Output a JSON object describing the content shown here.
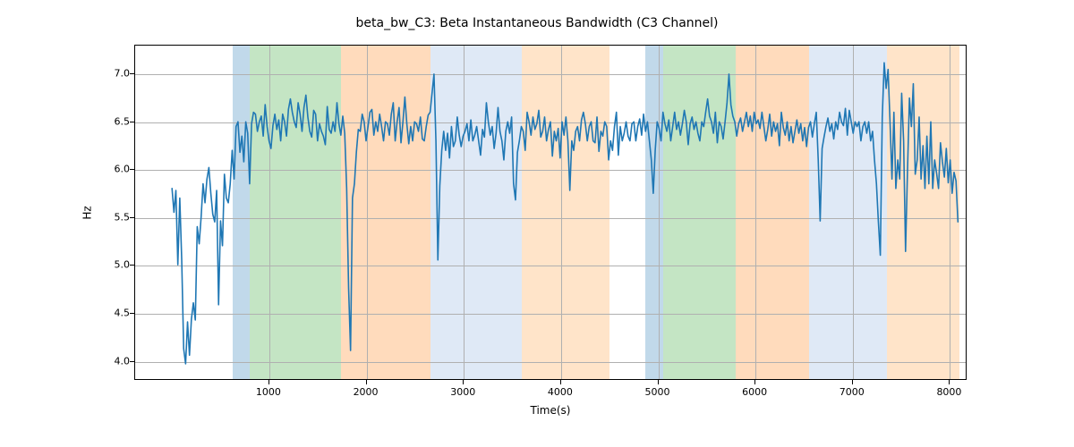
{
  "chart_data": {
    "type": "line",
    "title": "beta_bw_C3: Beta Instantaneous Bandwidth (C3 Channel)",
    "xlabel": "Time(s)",
    "ylabel": "Hz",
    "xlim": [
      -380,
      8180
    ],
    "ylim": [
      3.8,
      7.3
    ],
    "xticks": [
      1000,
      2000,
      3000,
      4000,
      5000,
      6000,
      7000,
      8000
    ],
    "yticks": [
      4.0,
      4.5,
      5.0,
      5.5,
      6.0,
      6.5,
      7.0
    ],
    "bands": [
      {
        "x0": 620,
        "x1": 800,
        "class": "blue"
      },
      {
        "x0": 800,
        "x1": 1740,
        "class": "green"
      },
      {
        "x0": 1740,
        "x1": 2660,
        "class": "orange"
      },
      {
        "x0": 2660,
        "x1": 3600,
        "class": "pale"
      },
      {
        "x0": 3600,
        "x1": 4500,
        "class": "peach"
      },
      {
        "x0": 4870,
        "x1": 5050,
        "class": "blue"
      },
      {
        "x0": 5050,
        "x1": 5800,
        "class": "green"
      },
      {
        "x0": 5800,
        "x1": 6550,
        "class": "orange"
      },
      {
        "x0": 6550,
        "x1": 7350,
        "class": "pale"
      },
      {
        "x0": 7350,
        "x1": 8100,
        "class": "peach"
      }
    ],
    "series": [
      {
        "name": "beta_bw_C3",
        "color": "#1f77b4",
        "x": [
          0,
          20,
          40,
          60,
          80,
          100,
          120,
          140,
          160,
          180,
          200,
          220,
          240,
          260,
          280,
          300,
          320,
          340,
          360,
          380,
          400,
          420,
          440,
          460,
          480,
          500,
          520,
          540,
          560,
          580,
          600,
          620,
          640,
          660,
          680,
          700,
          720,
          740,
          760,
          780,
          800,
          820,
          840,
          860,
          880,
          900,
          920,
          940,
          960,
          980,
          1000,
          1020,
          1040,
          1060,
          1080,
          1100,
          1120,
          1140,
          1160,
          1180,
          1200,
          1220,
          1240,
          1260,
          1280,
          1300,
          1320,
          1340,
          1360,
          1380,
          1400,
          1420,
          1440,
          1460,
          1480,
          1500,
          1520,
          1540,
          1560,
          1580,
          1600,
          1620,
          1640,
          1660,
          1680,
          1700,
          1720,
          1740,
          1760,
          1780,
          1800,
          1820,
          1840,
          1860,
          1880,
          1900,
          1920,
          1940,
          1960,
          1980,
          2000,
          2020,
          2040,
          2060,
          2080,
          2100,
          2120,
          2140,
          2160,
          2180,
          2200,
          2220,
          2240,
          2260,
          2280,
          2300,
          2320,
          2340,
          2360,
          2380,
          2400,
          2420,
          2440,
          2460,
          2480,
          2500,
          2520,
          2540,
          2560,
          2580,
          2600,
          2620,
          2640,
          2660,
          2680,
          2700,
          2720,
          2740,
          2760,
          2780,
          2800,
          2820,
          2840,
          2860,
          2880,
          2900,
          2920,
          2940,
          2960,
          2980,
          3000,
          3020,
          3040,
          3060,
          3080,
          3100,
          3120,
          3140,
          3160,
          3180,
          3200,
          3220,
          3240,
          3260,
          3280,
          3300,
          3320,
          3340,
          3360,
          3380,
          3400,
          3420,
          3440,
          3460,
          3480,
          3500,
          3520,
          3540,
          3560,
          3580,
          3600,
          3620,
          3640,
          3660,
          3680,
          3700,
          3720,
          3740,
          3760,
          3780,
          3800,
          3820,
          3840,
          3860,
          3880,
          3900,
          3920,
          3940,
          3960,
          3980,
          4000,
          4020,
          4040,
          4060,
          4080,
          4100,
          4120,
          4140,
          4160,
          4180,
          4200,
          4220,
          4240,
          4260,
          4280,
          4300,
          4320,
          4340,
          4360,
          4380,
          4400,
          4420,
          4440,
          4460,
          4480,
          4500,
          4520,
          4540,
          4560,
          4580,
          4600,
          4620,
          4640,
          4660,
          4680,
          4700,
          4720,
          4740,
          4760,
          4780,
          4800,
          4820,
          4840,
          4860,
          4880,
          4900,
          4920,
          4940,
          4960,
          4980,
          5000,
          5020,
          5040,
          5060,
          5080,
          5100,
          5120,
          5140,
          5160,
          5180,
          5200,
          5220,
          5240,
          5260,
          5280,
          5300,
          5320,
          5340,
          5360,
          5380,
          5400,
          5420,
          5440,
          5460,
          5480,
          5500,
          5520,
          5540,
          5560,
          5580,
          5600,
          5620,
          5640,
          5660,
          5680,
          5700,
          5720,
          5740,
          5760,
          5780,
          5800,
          5820,
          5840,
          5860,
          5880,
          5900,
          5920,
          5940,
          5960,
          5980,
          6000,
          6020,
          6040,
          6060,
          6080,
          6100,
          6120,
          6140,
          6160,
          6180,
          6200,
          6220,
          6240,
          6260,
          6280,
          6300,
          6320,
          6340,
          6360,
          6380,
          6400,
          6420,
          6440,
          6460,
          6480,
          6500,
          6520,
          6540,
          6560,
          6580,
          6600,
          6620,
          6640,
          6660,
          6680,
          6700,
          6720,
          6740,
          6760,
          6780,
          6800,
          6820,
          6840,
          6860,
          6880,
          6900,
          6920,
          6940,
          6960,
          6980,
          7000,
          7020,
          7040,
          7060,
          7080,
          7100,
          7120,
          7140,
          7160,
          7180,
          7200,
          7220,
          7240,
          7260,
          7280,
          7300,
          7320,
          7340,
          7360,
          7380,
          7400,
          7420,
          7440,
          7460,
          7480,
          7500,
          7520,
          7540,
          7560,
          7580,
          7600,
          7620,
          7640,
          7660,
          7680,
          7700,
          7720,
          7740,
          7760,
          7780,
          7800,
          7820,
          7840,
          7860,
          7880,
          7900,
          7920,
          7940,
          7960,
          7980,
          8000,
          8020,
          8040,
          8060,
          8080,
          8100
        ],
        "y": [
          5.8,
          5.55,
          5.78,
          5.0,
          5.7,
          5.05,
          4.12,
          3.96,
          4.4,
          4.05,
          4.43,
          4.6,
          4.42,
          5.4,
          5.22,
          5.5,
          5.85,
          5.65,
          5.9,
          6.02,
          5.75,
          5.53,
          5.45,
          5.78,
          4.58,
          5.46,
          5.2,
          5.95,
          5.7,
          5.65,
          5.85,
          6.2,
          5.9,
          6.45,
          6.5,
          6.18,
          6.35,
          6.08,
          6.5,
          6.38,
          5.85,
          6.48,
          6.6,
          6.58,
          6.4,
          6.5,
          6.56,
          6.35,
          6.68,
          6.45,
          6.3,
          6.22,
          6.46,
          6.58,
          6.42,
          6.52,
          6.3,
          6.58,
          6.5,
          6.35,
          6.63,
          6.74,
          6.6,
          6.5,
          6.44,
          6.7,
          6.58,
          6.4,
          6.65,
          6.78,
          6.55,
          6.4,
          6.34,
          6.62,
          6.58,
          6.3,
          6.48,
          6.4,
          6.35,
          6.26,
          6.66,
          6.42,
          6.38,
          6.5,
          6.4,
          6.7,
          6.48,
          6.36,
          6.56,
          6.38,
          5.8,
          4.75,
          4.1,
          5.7,
          5.85,
          6.18,
          6.42,
          6.4,
          6.58,
          6.5,
          6.3,
          6.45,
          6.6,
          6.63,
          6.36,
          6.5,
          6.4,
          6.58,
          6.45,
          6.3,
          6.5,
          6.48,
          6.36,
          6.58,
          6.7,
          6.3,
          6.5,
          6.65,
          6.28,
          6.5,
          6.76,
          6.48,
          6.27,
          6.45,
          6.3,
          6.5,
          6.48,
          6.4,
          6.55,
          6.32,
          6.3,
          6.45,
          6.57,
          6.6,
          6.8,
          7.0,
          6.3,
          5.05,
          5.83,
          6.2,
          6.4,
          6.2,
          6.38,
          6.12,
          6.45,
          6.24,
          6.3,
          6.55,
          6.36,
          6.24,
          6.35,
          6.4,
          6.48,
          6.3,
          6.52,
          6.3,
          6.36,
          6.45,
          6.3,
          6.15,
          6.42,
          6.34,
          6.7,
          6.5,
          6.36,
          6.45,
          6.22,
          6.38,
          6.65,
          6.4,
          6.3,
          6.1,
          6.4,
          6.5,
          6.38,
          6.55,
          5.85,
          5.68,
          6.18,
          6.3,
          6.45,
          6.4,
          6.2,
          6.6,
          6.5,
          6.36,
          6.55,
          6.42,
          6.48,
          6.62,
          6.34,
          6.4,
          6.55,
          6.3,
          6.42,
          6.5,
          6.14,
          6.4,
          6.3,
          6.43,
          6.12,
          6.5,
          6.36,
          6.55,
          6.3,
          5.78,
          6.3,
          6.2,
          6.4,
          6.45,
          6.3,
          6.52,
          6.6,
          6.48,
          6.3,
          6.45,
          6.5,
          6.3,
          6.28,
          6.55,
          6.19,
          6.4,
          6.35,
          6.5,
          6.45,
          6.1,
          6.3,
          6.2,
          6.45,
          6.6,
          6.15,
          6.45,
          6.3,
          6.38,
          6.5,
          6.35,
          6.3,
          6.48,
          6.5,
          6.3,
          6.45,
          6.53,
          6.36,
          6.58,
          6.4,
          6.5,
          6.3,
          6.1,
          5.75,
          6.2,
          6.5,
          6.43,
          6.3,
          6.6,
          6.48,
          6.4,
          6.52,
          6.3,
          6.45,
          6.6,
          6.42,
          6.5,
          6.36,
          6.48,
          6.62,
          6.5,
          6.26,
          6.48,
          6.55,
          6.42,
          6.5,
          6.38,
          6.3,
          6.5,
          6.45,
          6.6,
          6.74,
          6.56,
          6.5,
          6.38,
          6.6,
          6.28,
          6.5,
          6.45,
          6.32,
          6.5,
          6.7,
          7.0,
          6.68,
          6.56,
          6.5,
          6.35,
          6.48,
          6.54,
          6.4,
          6.5,
          6.6,
          6.45,
          6.56,
          6.4,
          6.6,
          6.48,
          6.52,
          6.43,
          6.6,
          6.45,
          6.3,
          6.42,
          6.58,
          6.35,
          6.5,
          6.4,
          6.48,
          6.25,
          6.6,
          6.44,
          6.36,
          6.5,
          6.3,
          6.45,
          6.28,
          6.4,
          6.52,
          6.38,
          6.48,
          6.3,
          6.44,
          6.24,
          6.44,
          6.5,
          6.34,
          6.48,
          6.6,
          6.1,
          5.46,
          6.22,
          6.34,
          6.45,
          6.54,
          6.4,
          6.48,
          6.32,
          6.5,
          6.42,
          6.6,
          6.5,
          6.46,
          6.64,
          6.36,
          6.62,
          6.5,
          6.38,
          6.5,
          6.45,
          6.5,
          6.3,
          6.45,
          6.5,
          6.38,
          6.5,
          6.3,
          6.4,
          6.1,
          5.85,
          5.45,
          5.1,
          6.55,
          7.12,
          6.85,
          7.05,
          6.5,
          5.9,
          6.6,
          5.8,
          6.1,
          5.9,
          6.8,
          6.3,
          5.14,
          5.98,
          6.75,
          6.45,
          6.9,
          5.95,
          6.1,
          6.55,
          5.9,
          6.25,
          5.8,
          6.35,
          5.85,
          6.5,
          5.8,
          6.1,
          5.96,
          5.8,
          6.28,
          6.08,
          5.92,
          6.22,
          5.86,
          6.1,
          5.75,
          5.97,
          5.88,
          5.45
        ]
      }
    ]
  }
}
